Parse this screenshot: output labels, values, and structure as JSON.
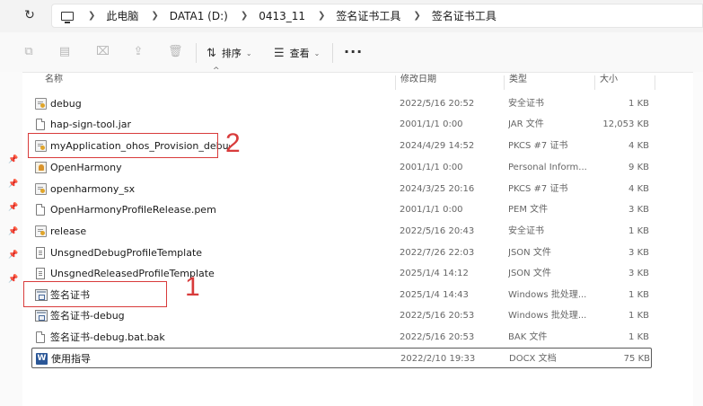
{
  "address_bar": {
    "crumbs": [
      "此电脑",
      "DATA1 (D:)",
      "0413_11",
      "签名证书工具",
      "签名证书工具"
    ]
  },
  "toolbar": {
    "sort_label": "排序",
    "view_label": "查看",
    "more_label": "···"
  },
  "columns": {
    "name": "名称",
    "modified": "修改日期",
    "type": "类型",
    "size": "大小"
  },
  "files": [
    {
      "name": "debug",
      "modified": "2022/5/16 20:52",
      "type": "安全证书",
      "size": "1 KB",
      "icon": "certificate-icon"
    },
    {
      "name": "hap-sign-tool.jar",
      "modified": "2001/1/1 0:00",
      "type": "JAR 文件",
      "size": "12,053 KB",
      "icon": "document-icon"
    },
    {
      "name": "myApplication_ohos_Provision_debug",
      "modified": "2024/4/29 14:52",
      "type": "PKCS #7 证书",
      "size": "4 KB",
      "icon": "certificate-icon"
    },
    {
      "name": "OpenHarmony",
      "modified": "2001/1/1 0:00",
      "type": "Personal Inform...",
      "size": "9 KB",
      "icon": "personal-info-icon"
    },
    {
      "name": "openharmony_sx",
      "modified": "2024/3/25 20:16",
      "type": "PKCS #7 证书",
      "size": "4 KB",
      "icon": "certificate-icon"
    },
    {
      "name": "OpenHarmonyProfileRelease.pem",
      "modified": "2001/1/1 0:00",
      "type": "PEM 文件",
      "size": "3 KB",
      "icon": "document-icon"
    },
    {
      "name": "release",
      "modified": "2022/5/16 20:43",
      "type": "安全证书",
      "size": "1 KB",
      "icon": "certificate-icon"
    },
    {
      "name": "UnsgnedDebugProfileTemplate",
      "modified": "2022/7/26 22:03",
      "type": "JSON 文件",
      "size": "3 KB",
      "icon": "text-file-icon"
    },
    {
      "name": "UnsgnedReleasedProfileTemplate",
      "modified": "2025/1/4 14:12",
      "type": "JSON 文件",
      "size": "3 KB",
      "icon": "text-file-icon"
    },
    {
      "name": "签名证书",
      "modified": "2025/1/4 14:43",
      "type": "Windows 批处理...",
      "size": "1 KB",
      "icon": "batch-file-icon"
    },
    {
      "name": "签名证书-debug",
      "modified": "2022/5/16 20:53",
      "type": "Windows 批处理...",
      "size": "1 KB",
      "icon": "batch-file-icon"
    },
    {
      "name": "签名证书-debug.bat.bak",
      "modified": "2022/5/16 20:53",
      "type": "BAK 文件",
      "size": "1 KB",
      "icon": "document-icon"
    },
    {
      "name": "使用指导",
      "modified": "2022/2/10 19:33",
      "type": "DOCX 文档",
      "size": "75 KB",
      "icon": "word-doc-icon"
    }
  ],
  "annotations": {
    "label_1": "1",
    "label_2": "2",
    "color": "#d83b3b"
  },
  "colors": {
    "selection_border": "#5a5a5a",
    "certificate_accent": "#e0a52a",
    "word_blue": "#2b5797"
  }
}
